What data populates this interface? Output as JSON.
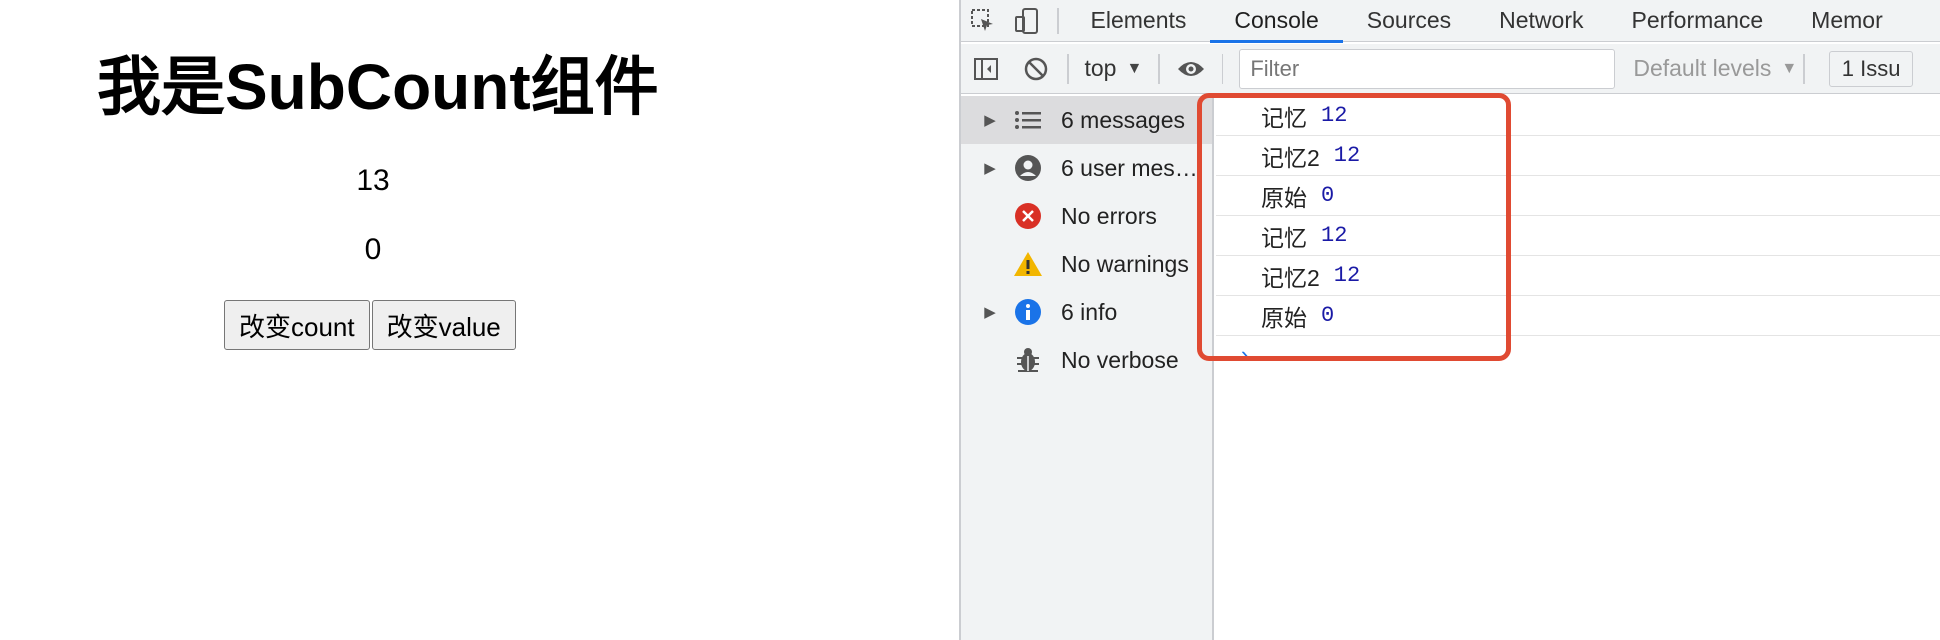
{
  "page": {
    "title": "我是SubCount组件",
    "count_value": "13",
    "value_value": "0",
    "buttons": {
      "change_count": "改变count",
      "change_value": "改变value"
    }
  },
  "devtools": {
    "tabs": [
      "Elements",
      "Console",
      "Sources",
      "Network",
      "Performance",
      "Memor"
    ],
    "active_tab": "Console",
    "toolbar": {
      "context": "top",
      "filter_placeholder": "Filter",
      "levels": "Default levels",
      "issues": "1 Issu"
    },
    "sidebar": [
      {
        "label": "6 messages",
        "icon": "list-icon",
        "expandable": true,
        "selected": true
      },
      {
        "label": "6 user mes…",
        "icon": "user-icon",
        "expandable": true,
        "selected": false
      },
      {
        "label": "No errors",
        "icon": "error-icon",
        "expandable": false,
        "selected": false
      },
      {
        "label": "No warnings",
        "icon": "warning-icon",
        "expandable": false,
        "selected": false
      },
      {
        "label": "6 info",
        "icon": "info-icon",
        "expandable": true,
        "selected": false
      },
      {
        "label": "No verbose",
        "icon": "bug-icon",
        "expandable": false,
        "selected": false
      }
    ],
    "console_logs": [
      {
        "text": "记忆",
        "value": "12"
      },
      {
        "text": "记忆2",
        "value": "12"
      },
      {
        "text": "原始",
        "value": "0"
      },
      {
        "text": "记忆",
        "value": "12"
      },
      {
        "text": "记忆2",
        "value": "12"
      },
      {
        "text": "原始",
        "value": "0"
      }
    ],
    "prompt_symbol": "›"
  },
  "colors": {
    "accent": "#1a73e8",
    "highlight": "#e04a32",
    "log_number": "#1a1aa6",
    "error": "#d93025",
    "warning": "#f2b600",
    "info": "#1a73e8"
  }
}
